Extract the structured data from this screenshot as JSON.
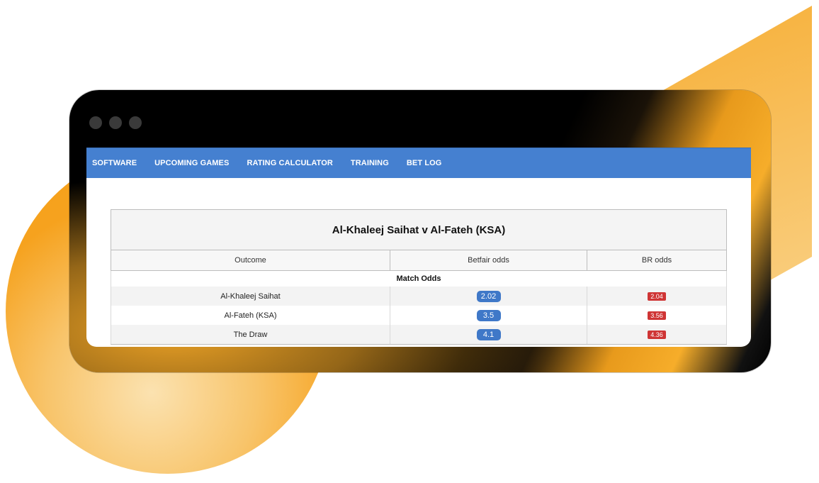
{
  "nav": {
    "items": [
      {
        "label": "SOFTWARE"
      },
      {
        "label": "UPCOMING GAMES"
      },
      {
        "label": "RATING CALCULATOR"
      },
      {
        "label": "TRAINING"
      },
      {
        "label": "BET LOG"
      }
    ]
  },
  "table": {
    "title": "Al-Khaleej Saihat v Al-Fateh (KSA)",
    "columns": [
      "Outcome",
      "Betfair odds",
      "BR odds"
    ],
    "section": "Match Odds",
    "rows": [
      {
        "outcome": "Al-Khaleej Saihat",
        "betfair": "2.02",
        "br": "2.04"
      },
      {
        "outcome": "Al-Fateh (KSA)",
        "betfair": "3.5",
        "br": "3.56"
      },
      {
        "outcome": "The Draw",
        "betfair": "4.1",
        "br": "4.36"
      }
    ]
  },
  "colors": {
    "nav_bg": "#4580d0",
    "betfair_badge": "#3f78c8",
    "br_badge": "#cf3535",
    "accent_orange": "#f5a623"
  }
}
